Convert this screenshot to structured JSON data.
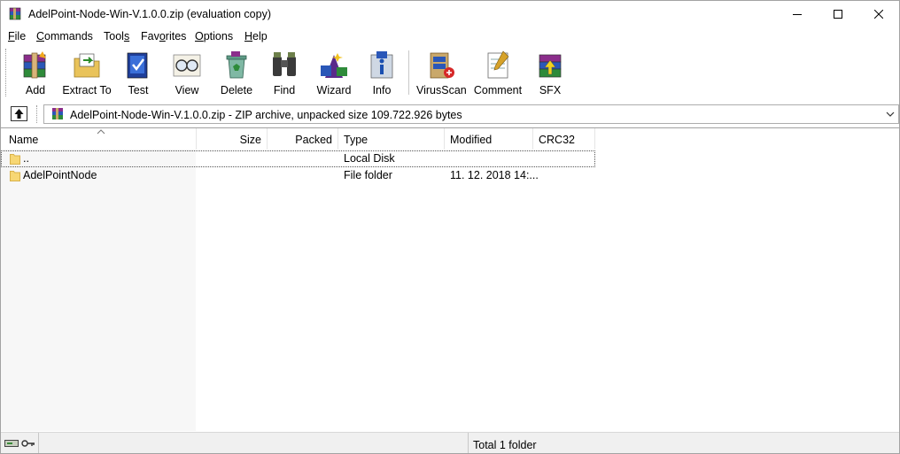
{
  "window": {
    "title": "AdelPoint-Node-Win-V.1.0.0.zip (evaluation copy)",
    "controls": [
      "minimize-icon",
      "maximize-icon",
      "close-icon"
    ]
  },
  "menu": [
    {
      "label": "File",
      "accel": "F",
      "rest": "ile"
    },
    {
      "label": "Commands",
      "accel": "C",
      "rest": "ommands"
    },
    {
      "label": "Tools",
      "pre": "Tool",
      "accel": "s",
      "rest": ""
    },
    {
      "label": "Favorites",
      "pre": "Fav",
      "accel": "o",
      "rest": "rites"
    },
    {
      "label": "Options",
      "accel": "O",
      "rest": "ptions"
    },
    {
      "label": "Help",
      "accel": "H",
      "rest": "elp"
    }
  ],
  "toolbar": {
    "add": "Add",
    "extract": "Extract To",
    "test": "Test",
    "view": "View",
    "delete": "Delete",
    "find": "Find",
    "wizard": "Wizard",
    "info": "Info",
    "virusscan": "VirusScan",
    "comment": "Comment",
    "sfx": "SFX"
  },
  "address": {
    "text": "AdelPoint-Node-Win-V.1.0.0.zip - ZIP archive, unpacked size 109.722.926 bytes"
  },
  "columns": {
    "name": "Name",
    "size": "Size",
    "packed": "Packed",
    "type": "Type",
    "modified": "Modified",
    "crc": "CRC32"
  },
  "files": [
    {
      "name": "..",
      "size": "",
      "packed": "",
      "type": "Local Disk",
      "modified": "",
      "crc": ""
    },
    {
      "name": "AdelPointNode",
      "size": "",
      "packed": "",
      "type": "File folder",
      "modified": "11. 12. 2018 14:...",
      "crc": ""
    }
  ],
  "status": {
    "text": "Total 1 folder"
  },
  "colors": {
    "folder": "#f7d774",
    "folder_edge": "#d9b24a",
    "accent_blue": "#1a5fb4"
  }
}
